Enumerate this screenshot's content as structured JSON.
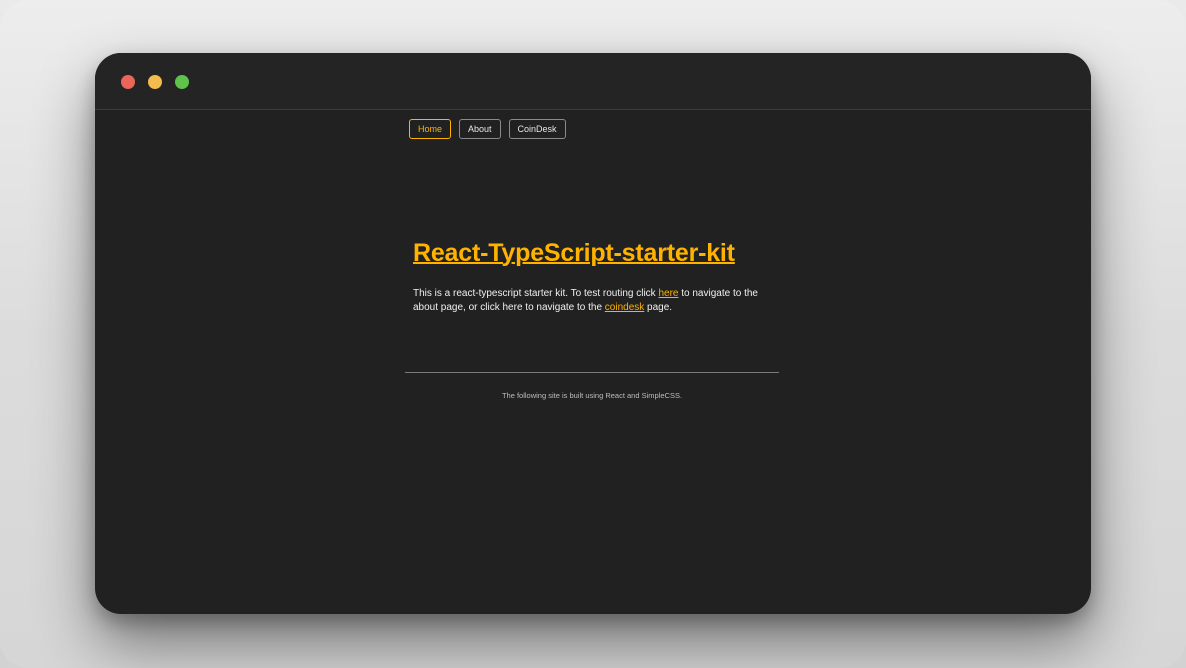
{
  "window": {
    "controls": [
      "close",
      "minimize",
      "maximize"
    ]
  },
  "nav": {
    "home_label": "Home",
    "about_label": "About",
    "coindesk_label": "CoinDesk",
    "active": "Home"
  },
  "main": {
    "title": "React-TypeScript-starter-kit",
    "intro": {
      "part1": "This is a react-typescript starter kit. To test routing click ",
      "link_here": "here",
      "part2": " to navigate to the about page, or click here to navigate to the ",
      "link_coindesk": "coindesk",
      "part3": " page."
    }
  },
  "footer": {
    "text": "The following site is built using React and SimpleCSS."
  },
  "colors": {
    "accent": "#ffb300",
    "window_bg": "#212121",
    "text": "#f0f0f0",
    "close_dot": "#ec6559",
    "minimize_dot": "#f2bc4f",
    "maximize_dot": "#5ec24c"
  }
}
